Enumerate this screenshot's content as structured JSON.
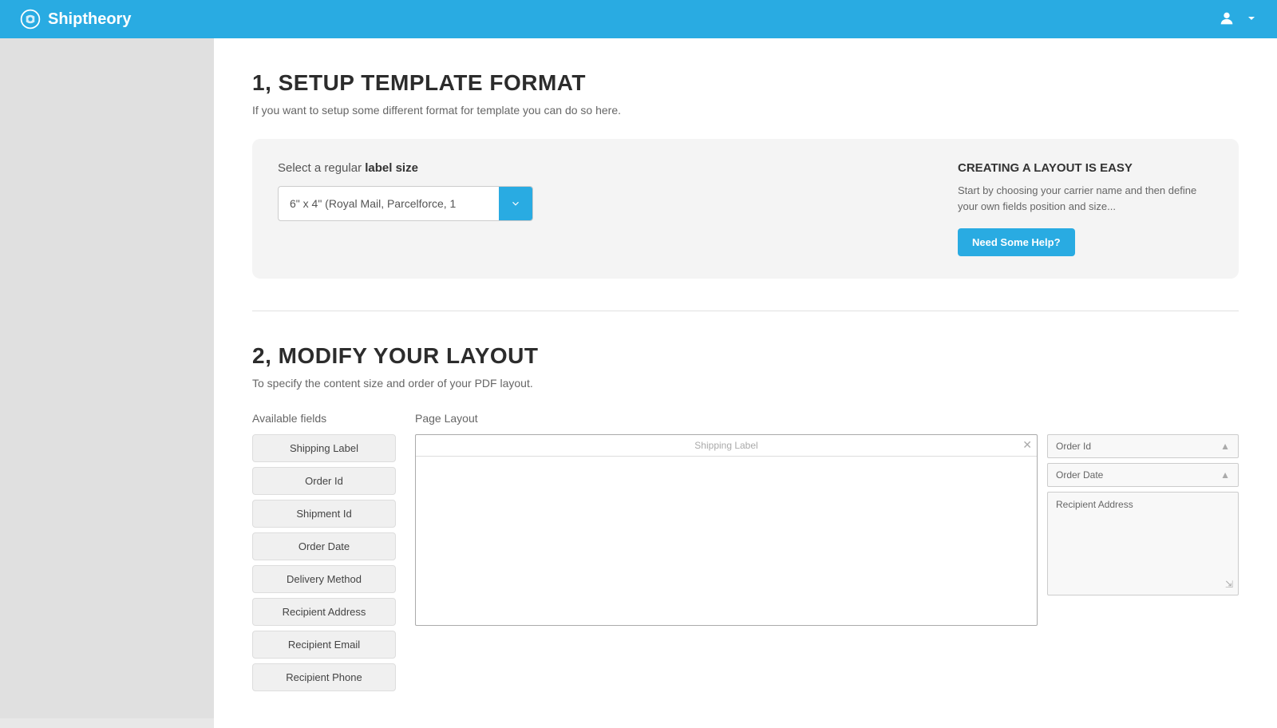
{
  "header": {
    "brand_name": "Shiptheory",
    "user_icon": "user",
    "dropdown_icon": "chevron-down"
  },
  "section1": {
    "title": "1, SETUP TEMPLATE FORMAT",
    "subtitle": "If you want to setup some different format for template you can do so here.",
    "label_size_label": "Select a regular ",
    "label_size_bold": "label size",
    "select_value": "6\" x 4\" (Royal Mail, Parcelforce, 1",
    "select_placeholder": "6\" x 4\" (Royal Mail, Parcelforce, 1",
    "help_title": "CREATING A LAYOUT IS EASY",
    "help_text": "Start by choosing your carrier name and then define your own fields position and size...",
    "help_btn_label": "Need Some Help?"
  },
  "section2": {
    "title": "2, MODIFY YOUR LAYOUT",
    "subtitle": "To specify the content size and order of your PDF layout.",
    "available_fields_header": "Available fields",
    "page_layout_header": "Page Layout",
    "available_fields": [
      "Shipping Label",
      "Order Id",
      "Shipment Id",
      "Order Date",
      "Delivery Method",
      "Recipient Address",
      "Recipient Email",
      "Recipient Phone"
    ],
    "layout_items_left": {
      "label": "Shipping Label"
    },
    "layout_items_right": [
      {
        "label": "Order Id",
        "resizable": true
      },
      {
        "label": "Order Date",
        "resizable": true
      },
      {
        "label": "Recipient Address",
        "resizable": true,
        "tall": true
      }
    ]
  }
}
